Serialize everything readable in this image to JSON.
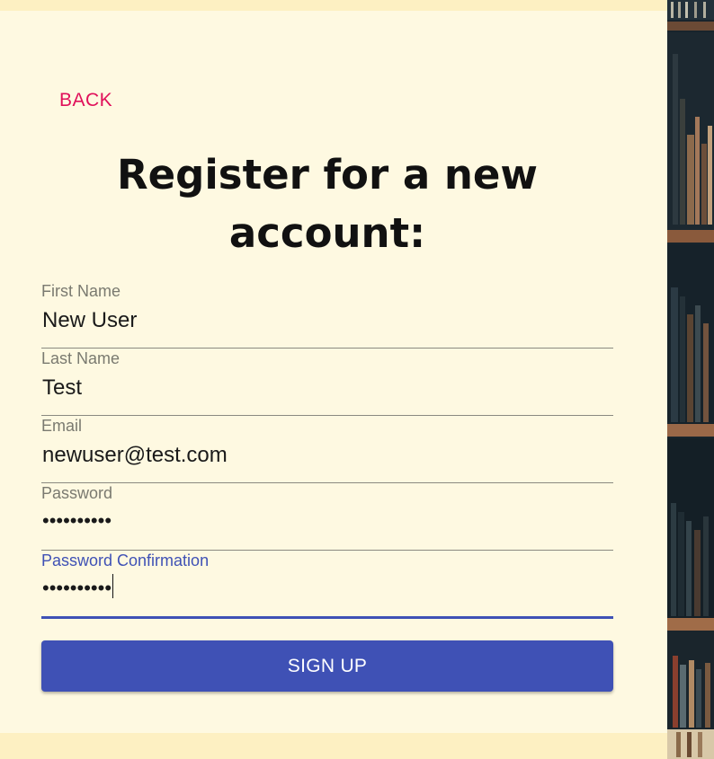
{
  "nav": {
    "back_label": "BACK"
  },
  "form": {
    "title": "Register for a new account:",
    "fields": [
      {
        "label": "First Name",
        "value": "New User"
      },
      {
        "label": "Last Name",
        "value": "Test"
      },
      {
        "label": "Email",
        "value": "newuser@test.com"
      },
      {
        "label": "Password",
        "value": "••••••••••"
      },
      {
        "label": "Password Confirmation",
        "value": "••••••••••"
      }
    ],
    "submit_label": "SIGN UP"
  },
  "colors": {
    "accent": "#3f51b5",
    "back_link": "#e0105a",
    "card_background": "#fef9e1",
    "page_background": "#fdf0c2"
  },
  "background_image": {
    "icon": "bookshelf-photo"
  }
}
